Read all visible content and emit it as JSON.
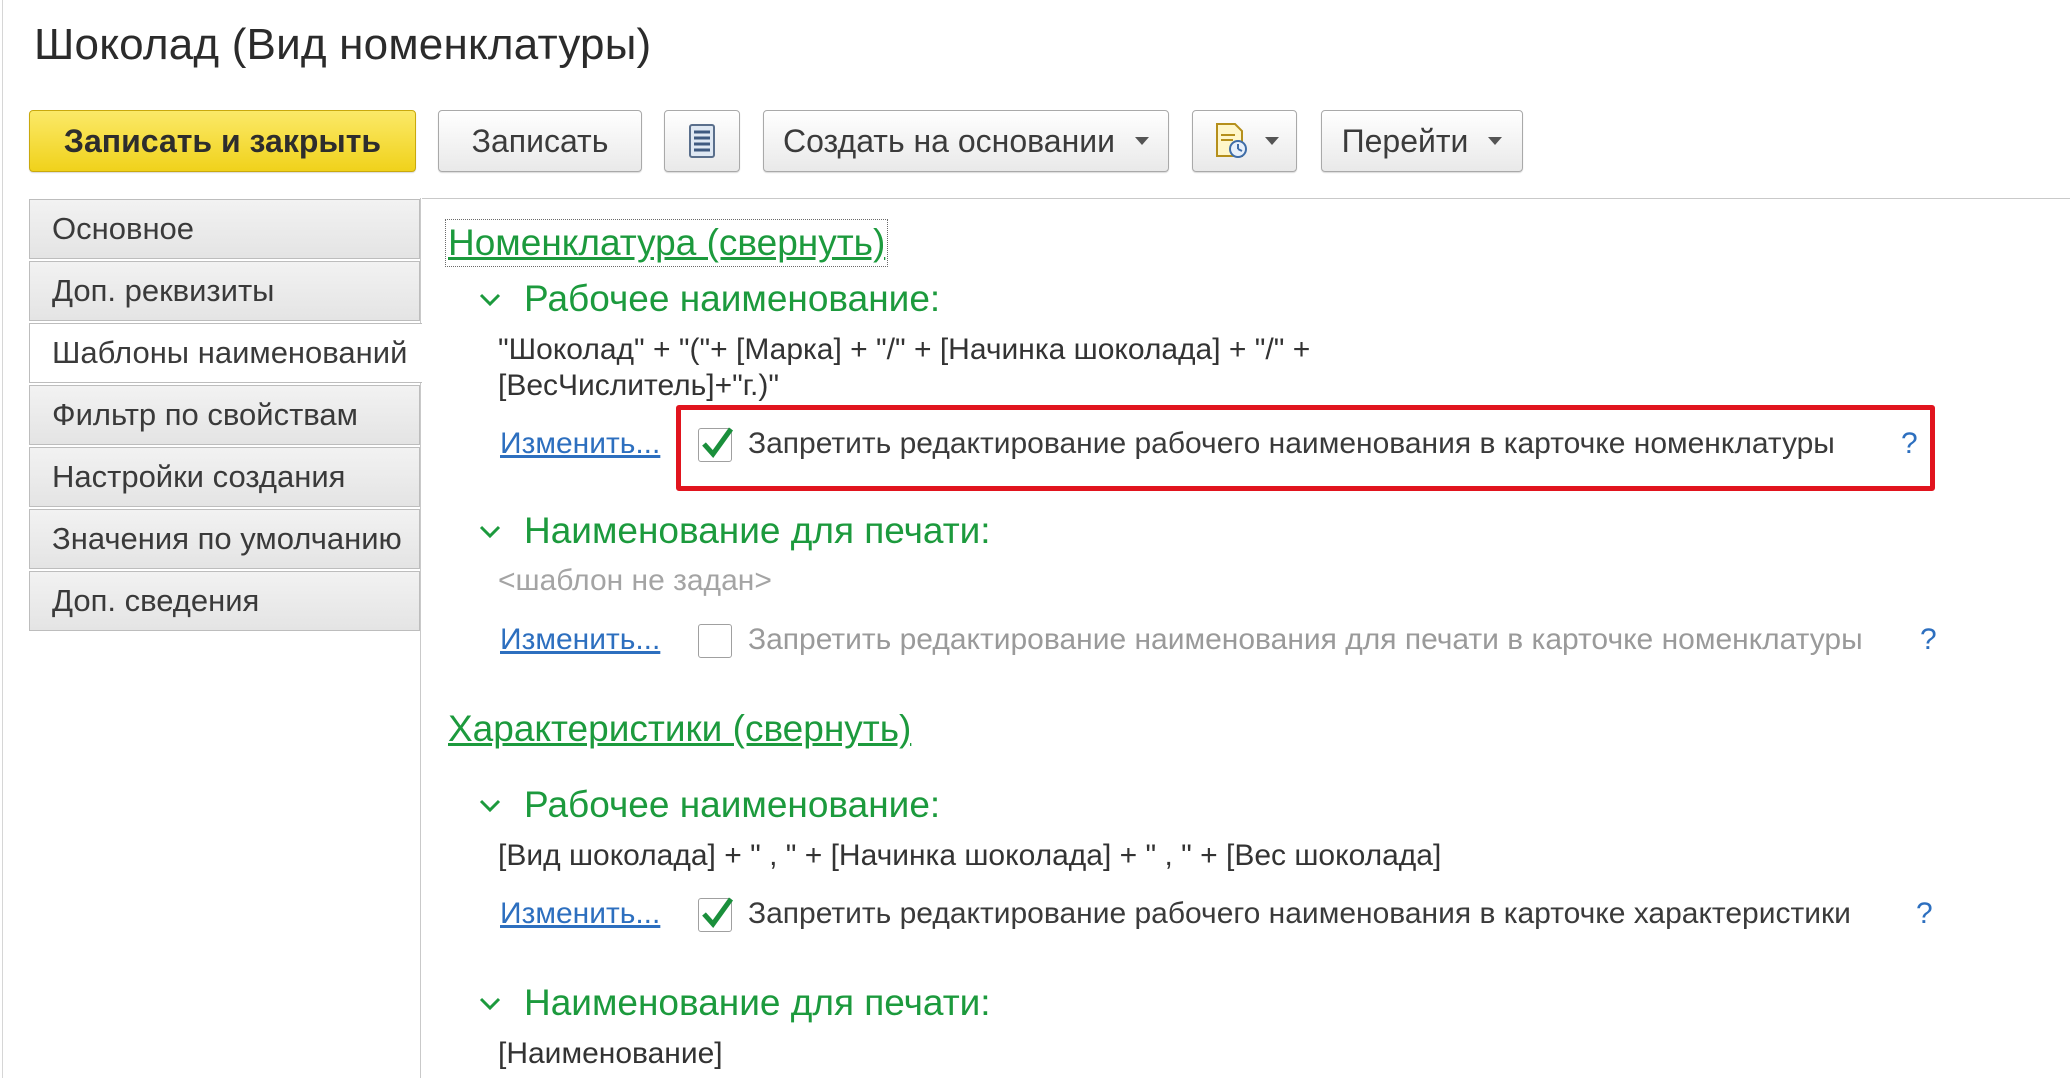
{
  "window": {
    "title": "Шоколад (Вид номенклатуры)"
  },
  "toolbar": {
    "save_close_label": "Записать и закрыть",
    "save_label": "Записать",
    "create_based_label": "Создать на основании",
    "goto_label": "Перейти"
  },
  "tabs": [
    {
      "label": "Основное",
      "active": false
    },
    {
      "label": "Доп. реквизиты",
      "active": false
    },
    {
      "label": "Шаблоны наименований",
      "active": true
    },
    {
      "label": "Фильтр по свойствам",
      "active": false
    },
    {
      "label": "Настройки создания",
      "active": false
    },
    {
      "label": "Значения по умолчанию",
      "active": false
    },
    {
      "label": "Доп. сведения",
      "active": false
    }
  ],
  "nomenclature": {
    "section_label": "Номенклатура (свернуть)",
    "working_name": {
      "heading": "Рабочее наименование:",
      "template_line1": "\"Шоколад\" + \"(\"+ [Марка] +  \"/\"  + [Начинка шоколада]  + \"/\"  +",
      "template_line2": "[ВесЧислитель]+\"г.)\"",
      "change_link": "Изменить...",
      "checkbox_label": "Запретить редактирование рабочего наименования в карточке номенклатуры",
      "checked": true,
      "help": "?"
    },
    "print_name": {
      "heading": "Наименование для печати:",
      "template": "<шаблон не задан>",
      "change_link": "Изменить...",
      "checkbox_label": "Запретить редактирование наименования для печати в карточке номенклатуры",
      "checked": false,
      "help": "?"
    }
  },
  "characteristics": {
    "section_label": "Характеристики (свернуть)",
    "working_name": {
      "heading": "Рабочее наименование:",
      "template": "[Вид шоколада] + \" , \" + [Начинка шоколада] + \" , \" + [Вес шоколада]",
      "change_link": "Изменить...",
      "checkbox_label": "Запретить редактирование рабочего наименования в карточке характеристики",
      "checked": true,
      "help": "?"
    },
    "print_name": {
      "heading": "Наименование для печати:",
      "template": "[Наименование]"
    }
  }
}
